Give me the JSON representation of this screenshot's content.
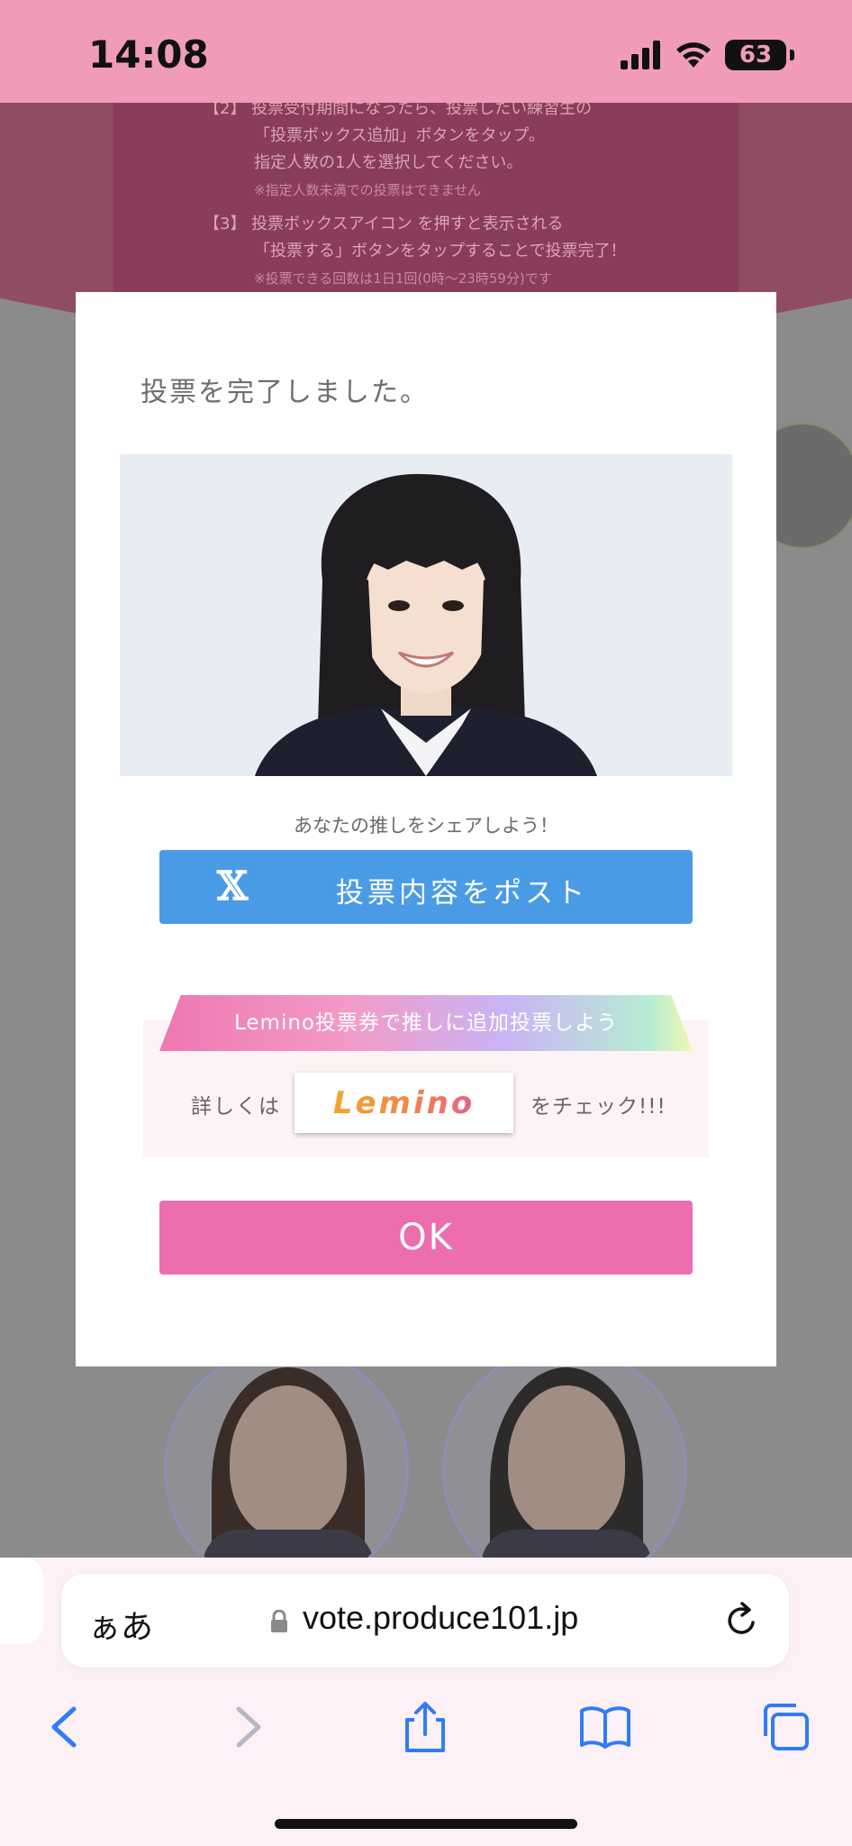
{
  "status_bar": {
    "time": "14:08",
    "battery": "63"
  },
  "background_page": {
    "lines": [
      "【2】 投票受付期間になったら、投票したい練習生の",
      "「投票ボックス追加」ボタンをタップ。",
      "指定人数の1人を選択してください。",
      "※指定人数未満での投票はできません",
      "【3】 投票ボックスアイコン を押すと表示される",
      "「投票する」ボタンをタップすることで投票完了！",
      "※投票できる回数は1日1回(0時〜23時59分)です"
    ]
  },
  "modal": {
    "title": "投票を完了しました。",
    "share_caption": "あなたの推しをシェアしよう！",
    "post_button_label": "投票内容をポスト",
    "post_icon": "𝕏",
    "lemino_banner": "Lemino投票券で推しに追加投票しよう",
    "detail_prefix": "詳しくは",
    "lemino_logo": "Lemino",
    "detail_suffix": "をチェック!!!",
    "ok_label": "OK"
  },
  "browser": {
    "aa_label": "ぁあ",
    "url": "vote.produce101.jp",
    "toolbar_icons": [
      "back-icon",
      "forward-icon",
      "share-icon",
      "bookmarks-icon",
      "tabs-icon"
    ]
  },
  "colors": {
    "status_bar": "#f09cb9",
    "post_button": "#4a9be6",
    "ok_button": "#ec6eaf",
    "toolbar_blue": "#2f7cf6"
  }
}
